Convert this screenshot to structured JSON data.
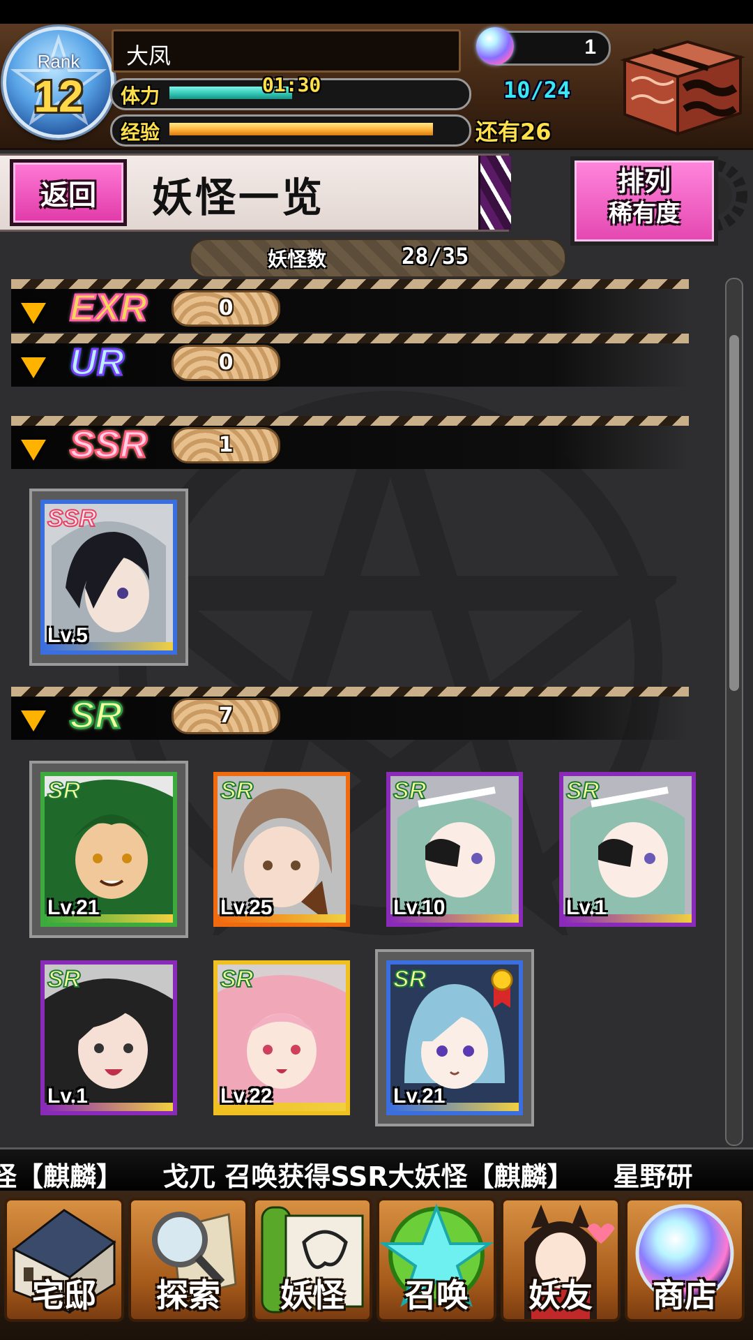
{
  "header": {
    "rank_label": "Rank",
    "rank": "12",
    "player_name": "大凤",
    "stamina_label": "体力",
    "stamina_timer": "01:30",
    "stamina_count": "10/24",
    "stamina_fraction": 0.42,
    "exp_label": "经验",
    "exp_remaining": "还有26",
    "exp_fraction": 0.9,
    "gem_count": "1"
  },
  "title_bar": {
    "back_label": "返回",
    "title": "妖怪一览",
    "sort_label": "排列",
    "sort_value": "稀有度"
  },
  "monster_count": {
    "label": "妖怪数",
    "value": "28/35"
  },
  "groups": [
    {
      "name": "EXR",
      "count": "0"
    },
    {
      "name": "UR",
      "count": "0"
    },
    {
      "name": "SSR",
      "count": "1"
    },
    {
      "name": "SR",
      "count": "7"
    }
  ],
  "cards": [
    {
      "rarity": "SSR",
      "level": "Lv.5",
      "frame_color": "#3b6fe0"
    },
    {
      "rarity": "SR",
      "level": "Lv.21",
      "frame_color": "#3caa3c"
    },
    {
      "rarity": "SR",
      "level": "Lv.25",
      "frame_color": "#f06a10"
    },
    {
      "rarity": "SR",
      "level": "Lv.10",
      "frame_color": "#8a2ab8"
    },
    {
      "rarity": "SR",
      "level": "Lv.1",
      "frame_color": "#8a2ab8"
    },
    {
      "rarity": "SR",
      "level": "Lv.1",
      "frame_color": "#8a2ab8"
    },
    {
      "rarity": "SR",
      "level": "Lv.22",
      "frame_color": "#f0c020"
    },
    {
      "rarity": "SR",
      "level": "Lv.21",
      "frame_color": "#3b6fe0"
    }
  ],
  "ticker": "怪【麒麟】　　戈兀 召唤获得SSR大妖怪【麒麟】　　星野研",
  "nav": [
    {
      "label": "宅邸",
      "icon": "mansion-icon"
    },
    {
      "label": "探索",
      "icon": "magnifier-icon"
    },
    {
      "label": "妖怪",
      "icon": "scroll-icon"
    },
    {
      "label": "召唤",
      "icon": "pentagram-icon"
    },
    {
      "label": "妖友",
      "icon": "friend-icon"
    },
    {
      "label": "商店",
      "icon": "crystal-orb-icon"
    }
  ],
  "colors": {
    "accent_pink": "#e447b0",
    "header_brown": "#3d2412",
    "stamina": "#2ec4b2",
    "exp": "#ffb33a"
  }
}
